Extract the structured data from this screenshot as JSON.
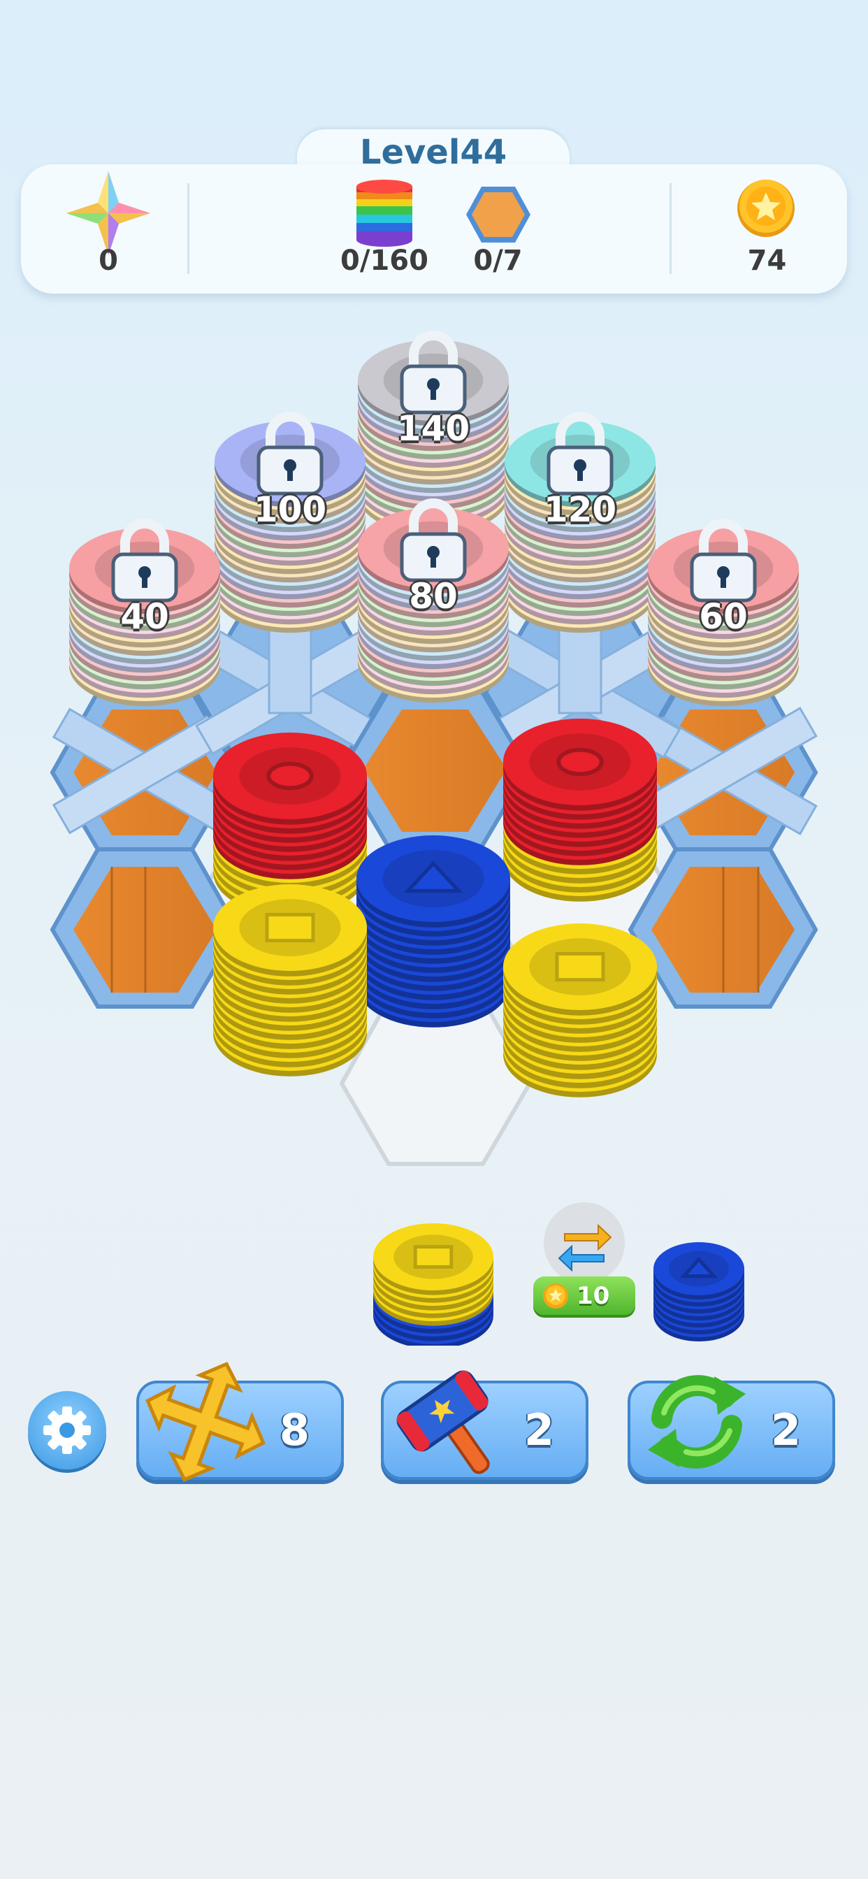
{
  "level": {
    "title": "Level44"
  },
  "stats": {
    "stars": "0",
    "discs": "0/160",
    "tiles": "0/7",
    "coins": "74"
  },
  "board": {
    "locked_stacks": [
      {
        "count": "140",
        "color": "#c9c9cf"
      },
      {
        "count": "100",
        "color": "#a9b4f6"
      },
      {
        "count": "120",
        "color": "#8ee6e4"
      },
      {
        "count": "80",
        "color": "#f6a4a8"
      },
      {
        "count": "40",
        "color": "#f6a0a4"
      },
      {
        "count": "60",
        "color": "#f6a0a4"
      }
    ],
    "disc_colors": {
      "red": "#e8212c",
      "yellow": "#f7d917",
      "blue": "#1a48d8"
    }
  },
  "queue": {
    "swap_cost": "10",
    "swap_icon": "swap-arrows-icon"
  },
  "boosters": [
    {
      "name": "move",
      "icon": "cross-arrows-icon",
      "count": "8"
    },
    {
      "name": "hammer",
      "icon": "hammer-icon",
      "count": "2"
    },
    {
      "name": "shuffle",
      "icon": "refresh-icon",
      "count": "2"
    }
  ],
  "settings": {
    "icon": "gear-icon"
  }
}
